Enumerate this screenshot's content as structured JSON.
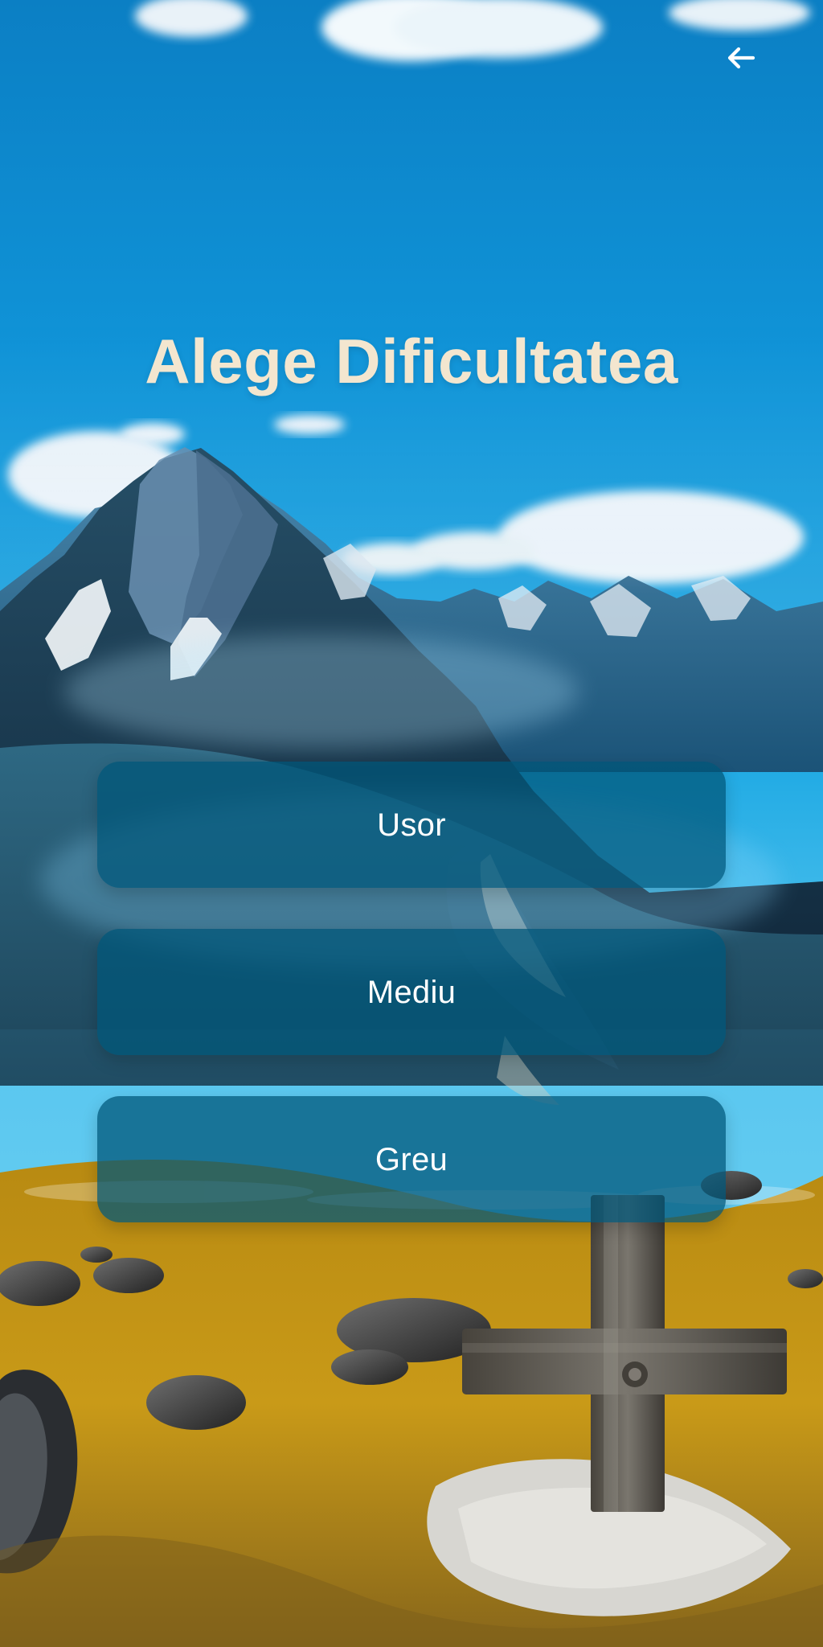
{
  "screen": {
    "title": "Alege Dificultatea"
  },
  "navigation": {
    "back_icon": "arrow-left-icon"
  },
  "difficulty_options": [
    {
      "label": "Usor"
    },
    {
      "label": "Mediu"
    },
    {
      "label": "Greu"
    }
  ],
  "theme": {
    "sky": "#0b84c8",
    "button": "#00567a",
    "title": "#f3e6cf",
    "button_text": "#ffffff"
  }
}
